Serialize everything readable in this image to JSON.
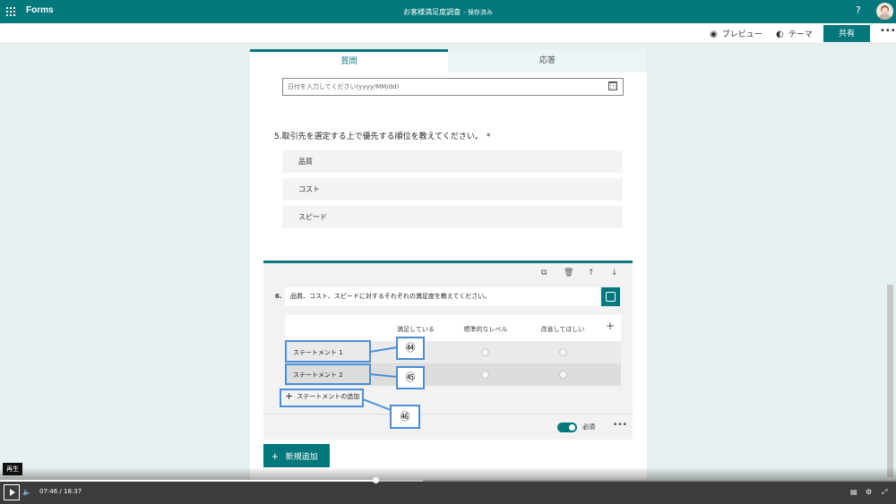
{
  "topbar": {
    "app_name": "Forms",
    "form_title": "お客様満足度調査",
    "saved_status": "- 保存済み",
    "help": "?"
  },
  "commands": {
    "preview": "プレビュー",
    "theme": "テーマ",
    "share": "共有",
    "more": "•••"
  },
  "tabs": {
    "questions": "質問",
    "responses": "応答"
  },
  "date_question": {
    "placeholder": "日付を入力してください(yyyy/MM/dd)"
  },
  "q5": {
    "title": "5.取引先を選定する上で優先する順位を教えてください。",
    "required_mark": "*",
    "items": [
      "品質",
      "コスト",
      "スピード"
    ]
  },
  "q6": {
    "number": "6.",
    "text": "品質、コスト、スピードに対するそれぞれの満足度を教えてください。",
    "columns": [
      "満足している",
      "標準的なレベル",
      "改善してほしい"
    ],
    "add_column": "+",
    "statements": [
      "ステートメント 1",
      "ステートメント 2"
    ],
    "add_statement": "ステートメントの追加",
    "required_label": "必須",
    "more": "•••"
  },
  "callouts": [
    "㊹",
    "㊺",
    "㊻"
  ],
  "new_button": "新規追加",
  "player": {
    "tooltip": "再生",
    "current_time": "07:46",
    "separator": "/",
    "duration": "18:37",
    "progress": 0.4185,
    "buffered": 0.472
  },
  "colors": {
    "accent": "#03787c",
    "callout": "#4a8ed9"
  }
}
